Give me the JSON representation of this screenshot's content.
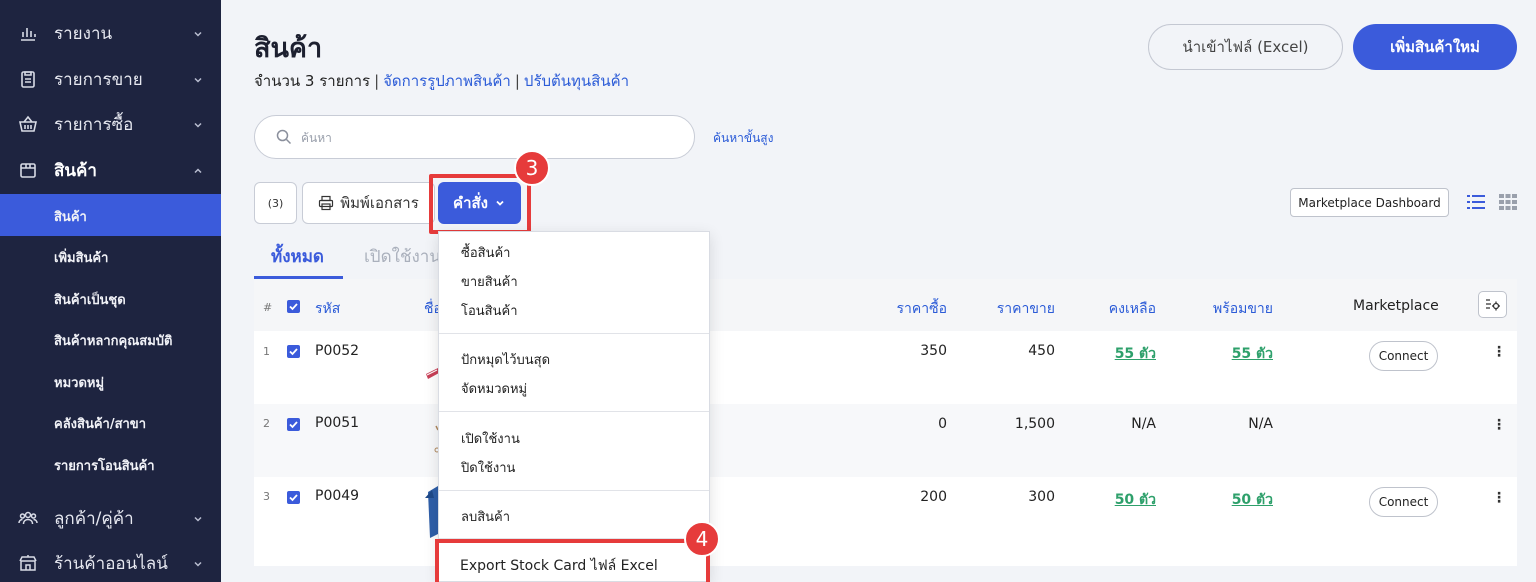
{
  "sidebar": {
    "items": [
      {
        "label": "รายงาน",
        "icon": "chart-icon"
      },
      {
        "label": "รายการขาย",
        "icon": "clipboard-icon"
      },
      {
        "label": "รายการซื้อ",
        "icon": "basket-icon"
      },
      {
        "label": "สินค้า",
        "icon": "box-icon"
      },
      {
        "label": "ลูกค้า/คู่ค้า",
        "icon": "people-icon"
      },
      {
        "label": "ร้านค้าออนไลน์",
        "icon": "shop-icon"
      }
    ],
    "sub_items": [
      "สินค้า",
      "เพิ่มสินค้า",
      "สินค้าเป็นชุด",
      "สินค้าหลากคุณสมบัติ",
      "หมวดหมู่",
      "คลังสินค้า/สาขา",
      "รายการโอนสินค้า"
    ]
  },
  "header": {
    "title": "สินค้า",
    "count_text": "จำนวน 3 รายการ",
    "link_manage_images": "จัดการรูปภาพสินค้า",
    "link_adjust_cost": "ปรับต้นทุนสินค้า",
    "import_label": "นำเข้าไฟล์ (Excel)",
    "add_label": "เพิ่มสินค้าใหม่"
  },
  "search": {
    "placeholder": "ค้นหา",
    "value": "",
    "advanced_label": "ค้นหาขั้นสูง"
  },
  "toolbar": {
    "selected_count": "(3)",
    "print_label": "พิมพ์เอกสาร",
    "command_label": "คำสั่ง",
    "marketplace_dashboard_label": "Marketplace Dashboard"
  },
  "badges": {
    "step3": "3",
    "step4": "4"
  },
  "tabs": [
    {
      "label": "ทั้งหมด"
    },
    {
      "label": "เปิดใช้งาน"
    }
  ],
  "table": {
    "headers": {
      "hash": "#",
      "code": "รหัส",
      "name": "ชื่อ",
      "buy": "ราคาซื้อ",
      "sell": "ราคาขาย",
      "remain": "คงเหลือ",
      "ready": "พร้อมขาย",
      "marketplace": "Marketplace"
    },
    "rows": [
      {
        "idx": "1",
        "code": "P0052",
        "buy": "350",
        "sell": "450",
        "remain": "55 ตัว",
        "ready": "55 ตัว",
        "connect": "Connect"
      },
      {
        "idx": "2",
        "code": "P0051",
        "buy": "0",
        "sell": "1,500",
        "remain": "N/A",
        "ready": "N/A",
        "connect": ""
      },
      {
        "idx": "3",
        "code": "P0049",
        "buy": "200",
        "sell": "300",
        "remain": "50 ตัว",
        "ready": "50 ตัว",
        "connect": "Connect"
      }
    ]
  },
  "dropdown": {
    "groups": [
      [
        "ซื้อสินค้า",
        "ขายสินค้า",
        "โอนสินค้า"
      ],
      [
        "ปักหมุดไว้บนสุด",
        "จัดหมวดหมู่"
      ],
      [
        "เปิดใช้งาน",
        "ปิดใช้งาน"
      ],
      [
        "ลบสินค้า"
      ]
    ],
    "export_label": "Export Stock Card ไฟล์ Excel"
  },
  "colors": {
    "sidebar_bg": "#1e2440",
    "accent": "#3b5bdb",
    "highlight": "#e63b3b",
    "stock_green": "#2ea06b"
  }
}
